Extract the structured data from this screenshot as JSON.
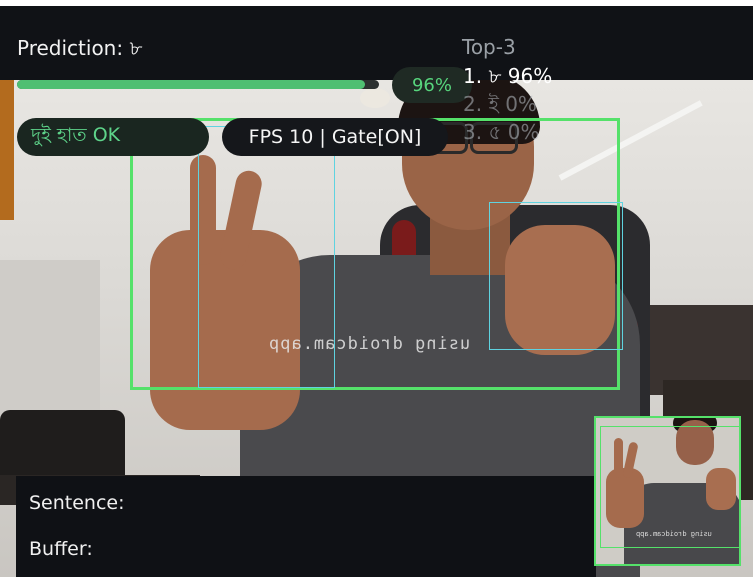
{
  "hud": {
    "prediction_label": "Prediction: ৮",
    "confidence_text": "96%",
    "confidence_fraction": 0.96,
    "top3_title": "Top-3",
    "top3": [
      {
        "text": "1. ৮ 96%"
      },
      {
        "text": "2. ই 0%"
      },
      {
        "text": "3. ৫ 0%"
      }
    ],
    "status_pill": "দুই হাত OK",
    "fps_pill": "FPS 10 | Gate[ON]"
  },
  "camera": {
    "watermark": "using droidcam.app"
  },
  "panel": {
    "sentence_label": "Sentence:",
    "buffer_label": "Buffer:"
  },
  "colors": {
    "accent_green": "#55e16a",
    "confidence_green": "#4fbf72",
    "hand_box_cyan": "#5fd3e0",
    "hud_background": "#101216"
  }
}
